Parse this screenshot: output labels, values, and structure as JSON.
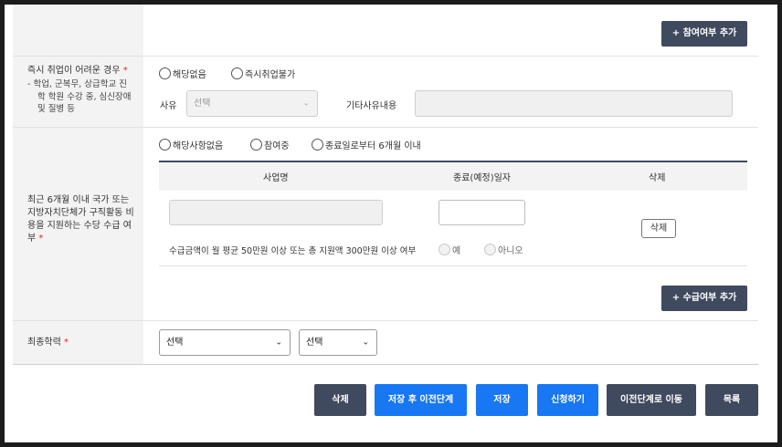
{
  "top_section": {
    "add_participation_button": "+ 참여여부 추가"
  },
  "employment_difficulty": {
    "label": "즉시 취업이 어려운 경우",
    "required_mark": "*",
    "note_lines": [
      "-  학업, 군복무, 상급학교 진",
      "학 학원 수강 중, 심신장애",
      "및 질병 등"
    ],
    "options": [
      "해당없음",
      "즉시취업불가"
    ],
    "reason_label": "사유",
    "reason_select_value": "선택",
    "other_reason_label": "기타사유내용"
  },
  "support_recipient": {
    "label_lines": [
      "최근 6개월 이내 국가 또는",
      "지방자치단체가 구직활동 비",
      "용을 지원하는 수당 수급 여",
      "부"
    ],
    "required_mark": "*",
    "options": [
      "해당사항없음",
      "참여중",
      "종료일로부터 6개월 이내"
    ],
    "table": {
      "headers": [
        "사업명",
        "종료(예정)일자",
        "삭제"
      ],
      "delete_button": "삭제",
      "amount_question": "수급금액이 월 평균 50만원 이상 또는 총 지원액 300만원 이상 여부",
      "amount_options": [
        "예",
        "아니오"
      ]
    },
    "add_button": "+ 수급여부 추가"
  },
  "education": {
    "label": "최종학력",
    "required_mark": "*",
    "select1_value": "선택",
    "select2_value": "선택"
  },
  "footer_buttons": {
    "delete": "삭제",
    "save_prev": "저장 후 이전단계",
    "save": "저장",
    "apply": "신청하기",
    "go_prev": "이전단계로 이동",
    "list": "목록"
  },
  "colors": {
    "dark_button": "#3f4a5e",
    "blue_button": "#1877f2",
    "required": "#d9263b"
  }
}
